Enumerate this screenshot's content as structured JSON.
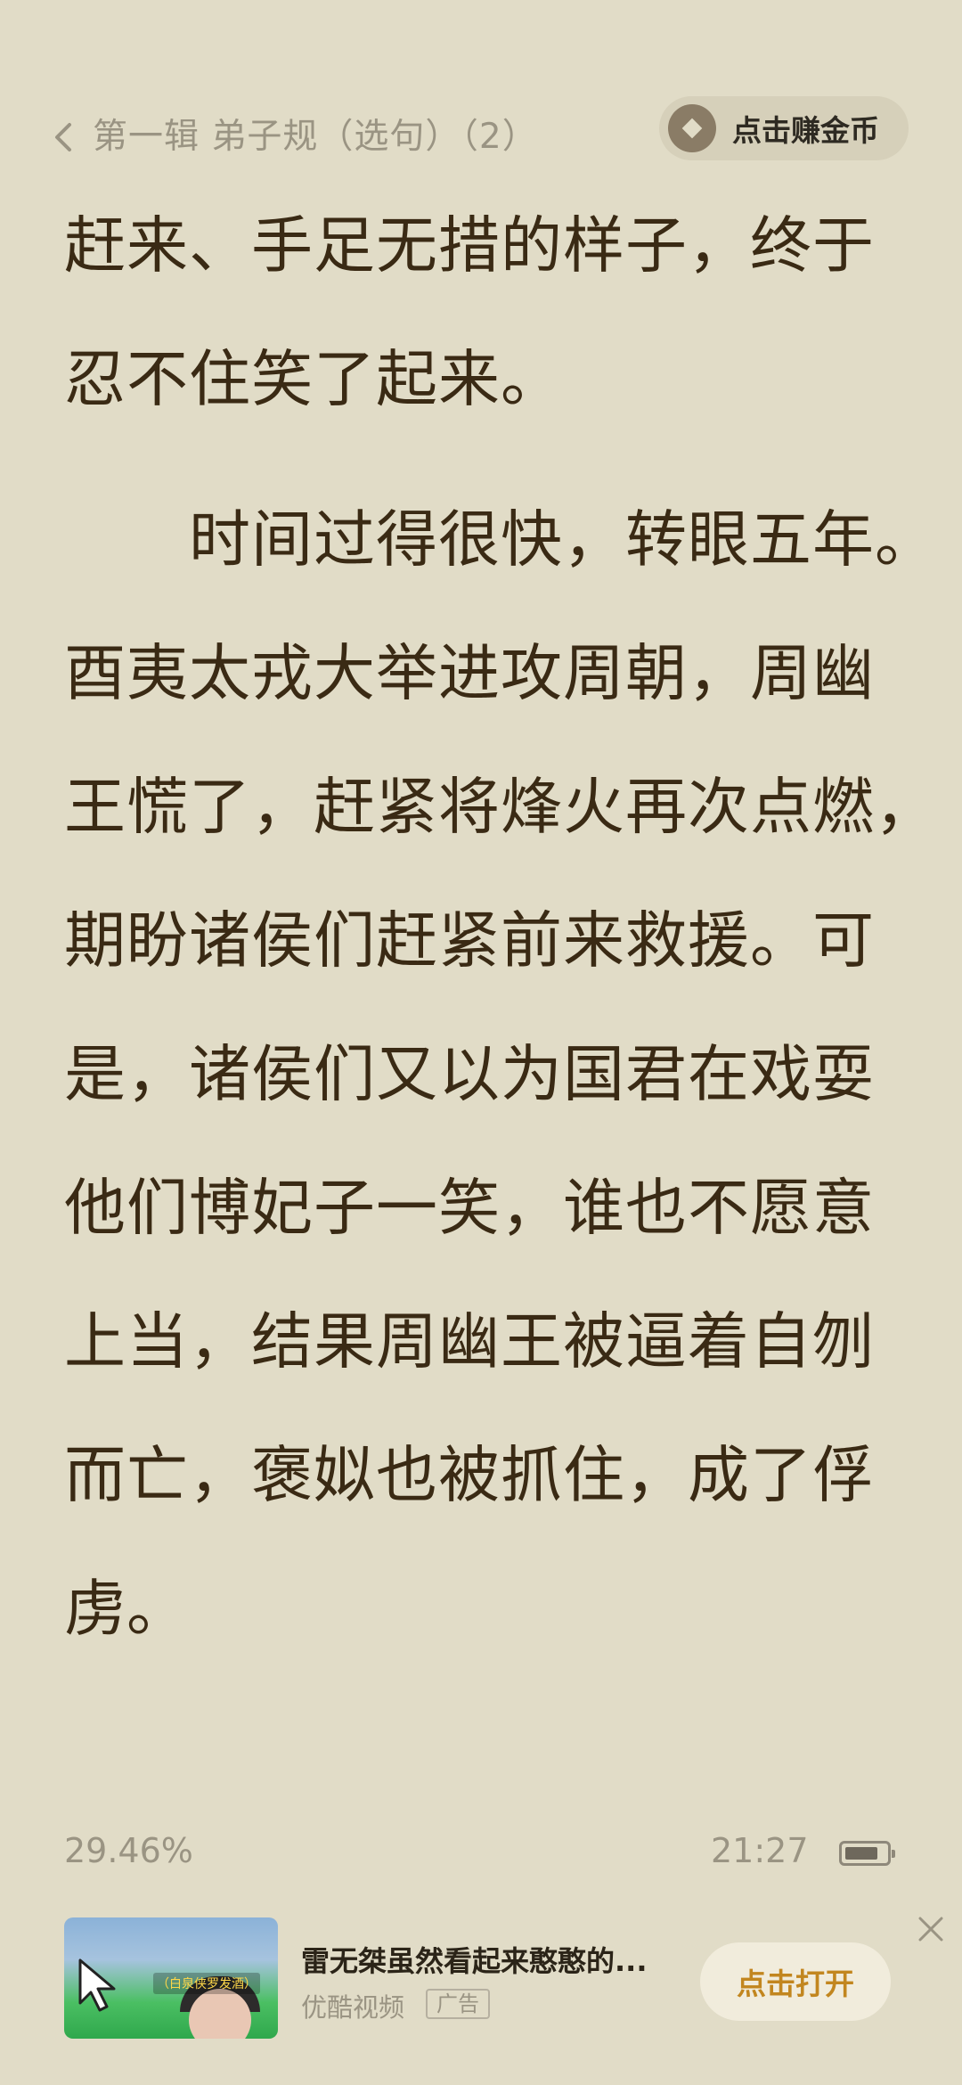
{
  "header": {
    "chapter_title": "第一辑 弟子规（选句）（2）",
    "earn_coins_label": "点击赚金币"
  },
  "article": {
    "lines": [
      "赶来、手足无措的样子，终于",
      "忍不住笑了起来。",
      "　　时间过得很快，转眼五年。",
      "酉夷太戎大举进攻周朝，周幽",
      "王慌了，赶紧将烽火再次点燃，",
      "期盼诸侯们赶紧前来救援。可",
      "是，诸侯们又以为国君在戏耍",
      "他们博妃子一笑，谁也不愿意",
      "上当，结果周幽王被逼着自刎",
      "而亡，褒姒也被抓住，成了俘",
      "虏。"
    ]
  },
  "status": {
    "progress": "29.46%",
    "time": "21:27",
    "battery_level": 0.75
  },
  "ad": {
    "thumbnail_tag": "（白泉侠罗发酒）",
    "title": "雷无桀虽然看起来憨憨的...",
    "source": "优酷视频",
    "badge": "广告",
    "open_label": "点击打开"
  },
  "colors": {
    "background": "#e1dcc7",
    "text": "#3a2a14",
    "muted": "#9a9483",
    "accent": "#c2861f"
  }
}
